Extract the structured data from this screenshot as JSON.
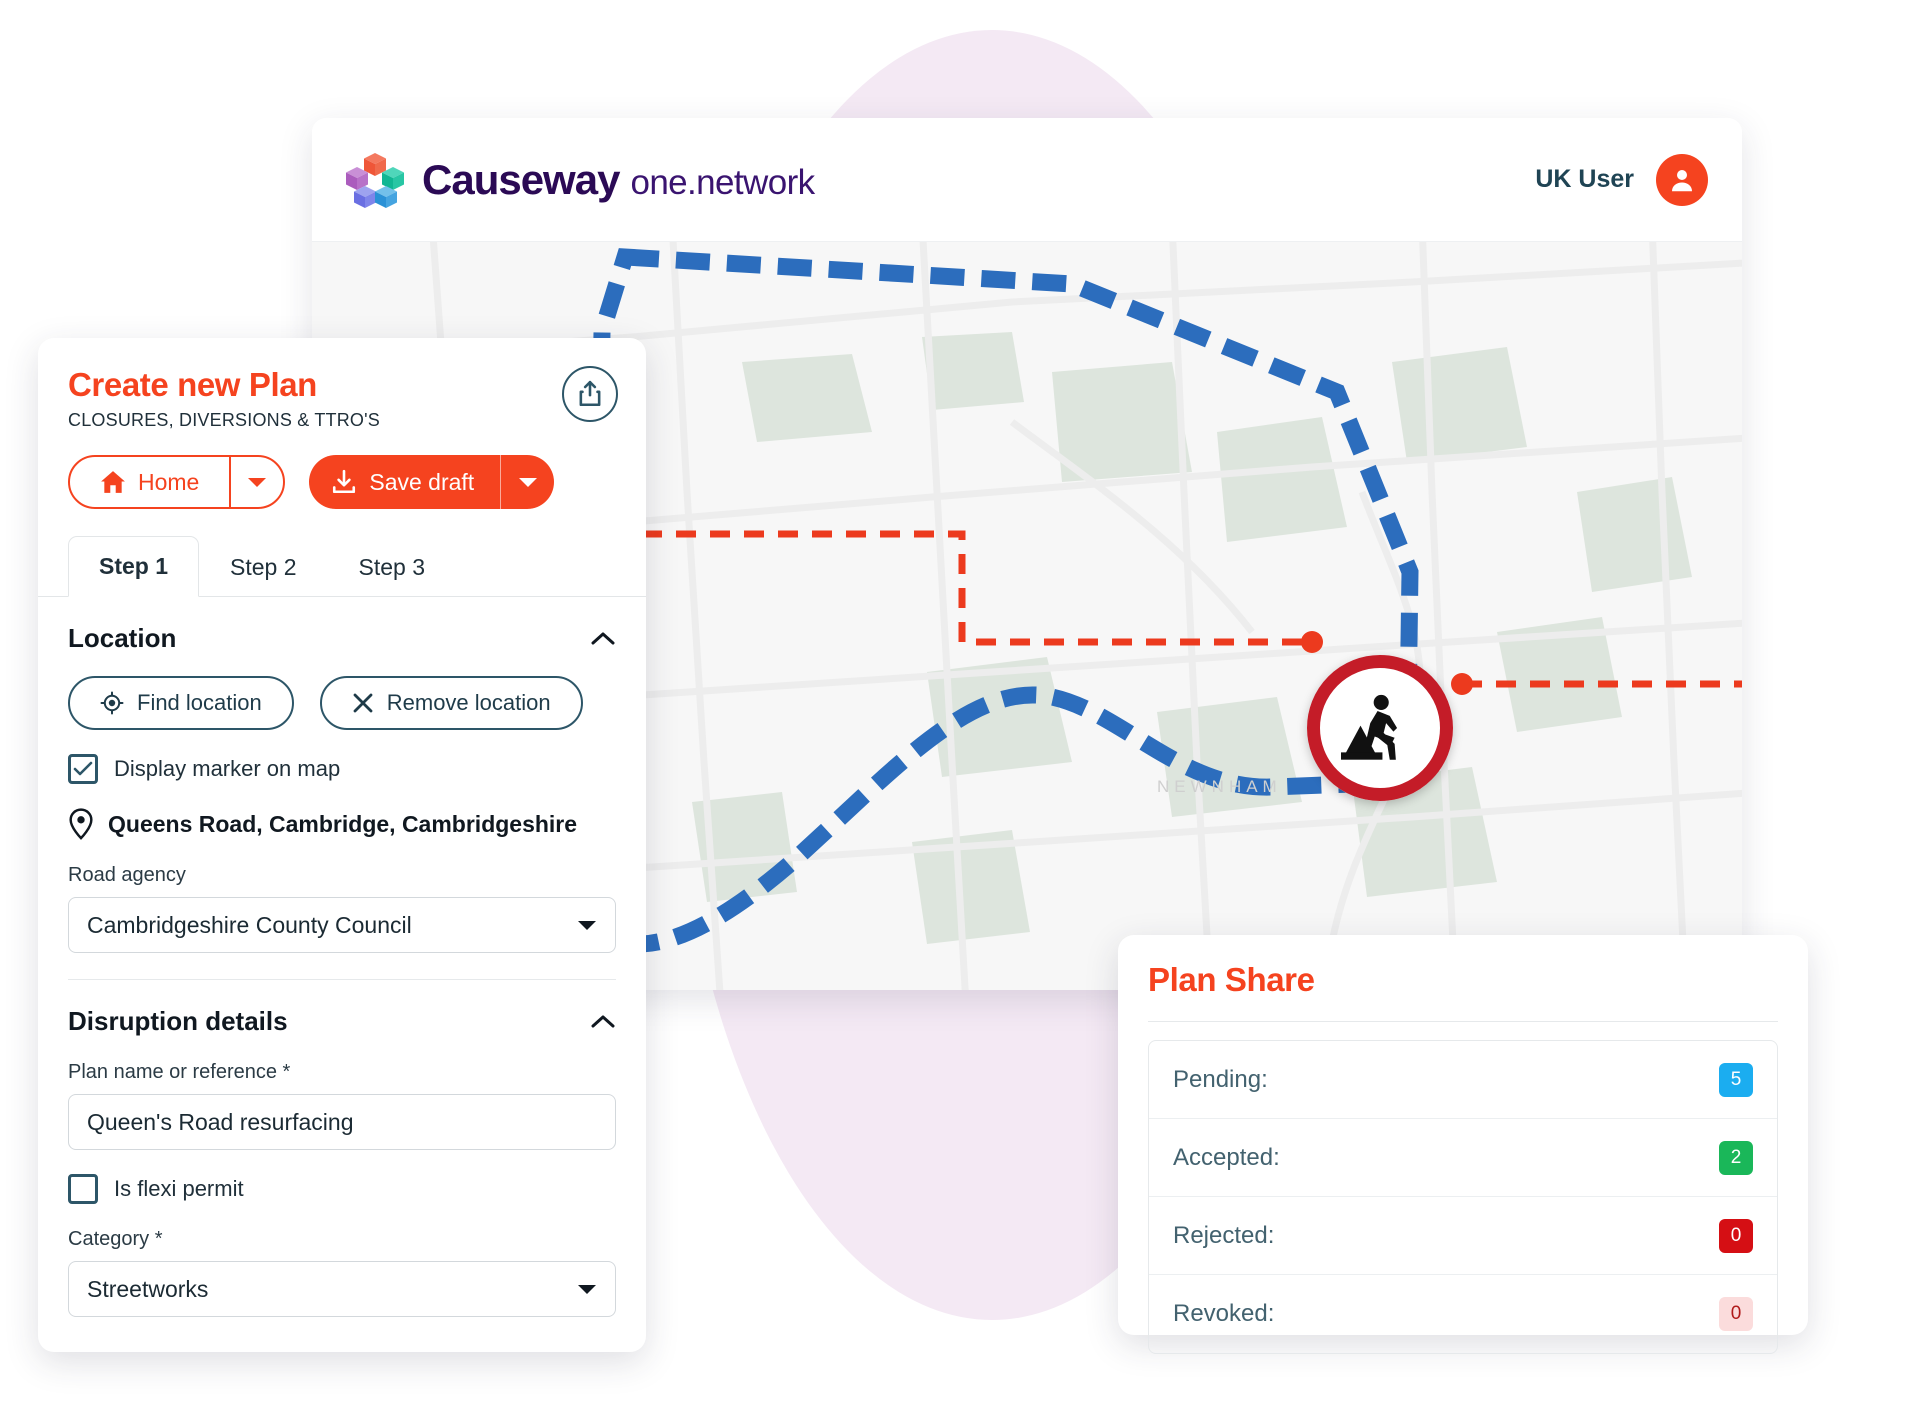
{
  "brand": {
    "name_bold": "Causeway",
    "name_light": "one.network",
    "logo_icon": "causeway-cubes-logo",
    "cube_colors": [
      "#f0563c",
      "#b46cc4",
      "#1fbf9c",
      "#7b7ee8",
      "#3e9fe0"
    ]
  },
  "header": {
    "user_name": "UK User",
    "avatar_icon": "user-avatar-icon",
    "accent": "#f5431f"
  },
  "map": {
    "label": "NEWNHAM",
    "marker_icon": "roadworks-sign-icon",
    "diversion_color": "#2c6dbd",
    "closure_color": "#ec3a1e",
    "base_color": "#f6f6f6",
    "park_color": "#dce5dd"
  },
  "plan_panel": {
    "title": "Create new Plan",
    "subtitle": "CLOSURES, DIVERSIONS & TTRO'S",
    "share_icon": "share-upload-icon",
    "home_button": {
      "label": "Home",
      "icon": "home-icon",
      "caret_icon": "chevron-down-icon"
    },
    "save_button": {
      "label": "Save draft",
      "icon": "download-icon",
      "caret_icon": "chevron-down-icon"
    },
    "tabs": [
      {
        "label": "Step 1",
        "active": true
      },
      {
        "label": "Step 2",
        "active": false
      },
      {
        "label": "Step 3",
        "active": false
      }
    ],
    "location": {
      "section_title": "Location",
      "collapse_icon": "chevron-up-icon",
      "find_button": {
        "label": "Find location",
        "icon": "crosshair-icon"
      },
      "remove_button": {
        "label": "Remove location",
        "icon": "close-x-icon"
      },
      "marker_checkbox": {
        "label": "Display marker on map",
        "checked": true,
        "icon": "checkmark-icon"
      },
      "address": "Queens Road, Cambridge, Cambridgeshire",
      "address_icon": "map-pin-icon",
      "road_agency": {
        "label": "Road agency",
        "value": "Cambridgeshire County Council",
        "caret_icon": "chevron-down-icon"
      }
    },
    "disruption": {
      "section_title": "Disruption details",
      "collapse_icon": "chevron-up-icon",
      "plan_name": {
        "label": "Plan name or reference *",
        "value": "Queen's Road resurfacing",
        "placeholder": "Plan name or reference"
      },
      "flexi_checkbox": {
        "label": "Is flexi permit",
        "checked": false
      },
      "category": {
        "label": "Category *",
        "value": "Streetworks",
        "caret_icon": "chevron-down-icon"
      }
    }
  },
  "plan_share": {
    "title": "Plan Share",
    "rows": [
      {
        "label": "Pending:",
        "count": "5",
        "bg": "#1badf0",
        "fg": "#ffffff"
      },
      {
        "label": "Accepted:",
        "count": "2",
        "bg": "#1ab759",
        "fg": "#ffffff"
      },
      {
        "label": "Rejected:",
        "count": "0",
        "bg": "#d50f14",
        "fg": "#ffffff"
      },
      {
        "label": "Revoked:",
        "count": "0",
        "bg": "#fbdcdc",
        "fg": "#b01b1b"
      }
    ]
  }
}
